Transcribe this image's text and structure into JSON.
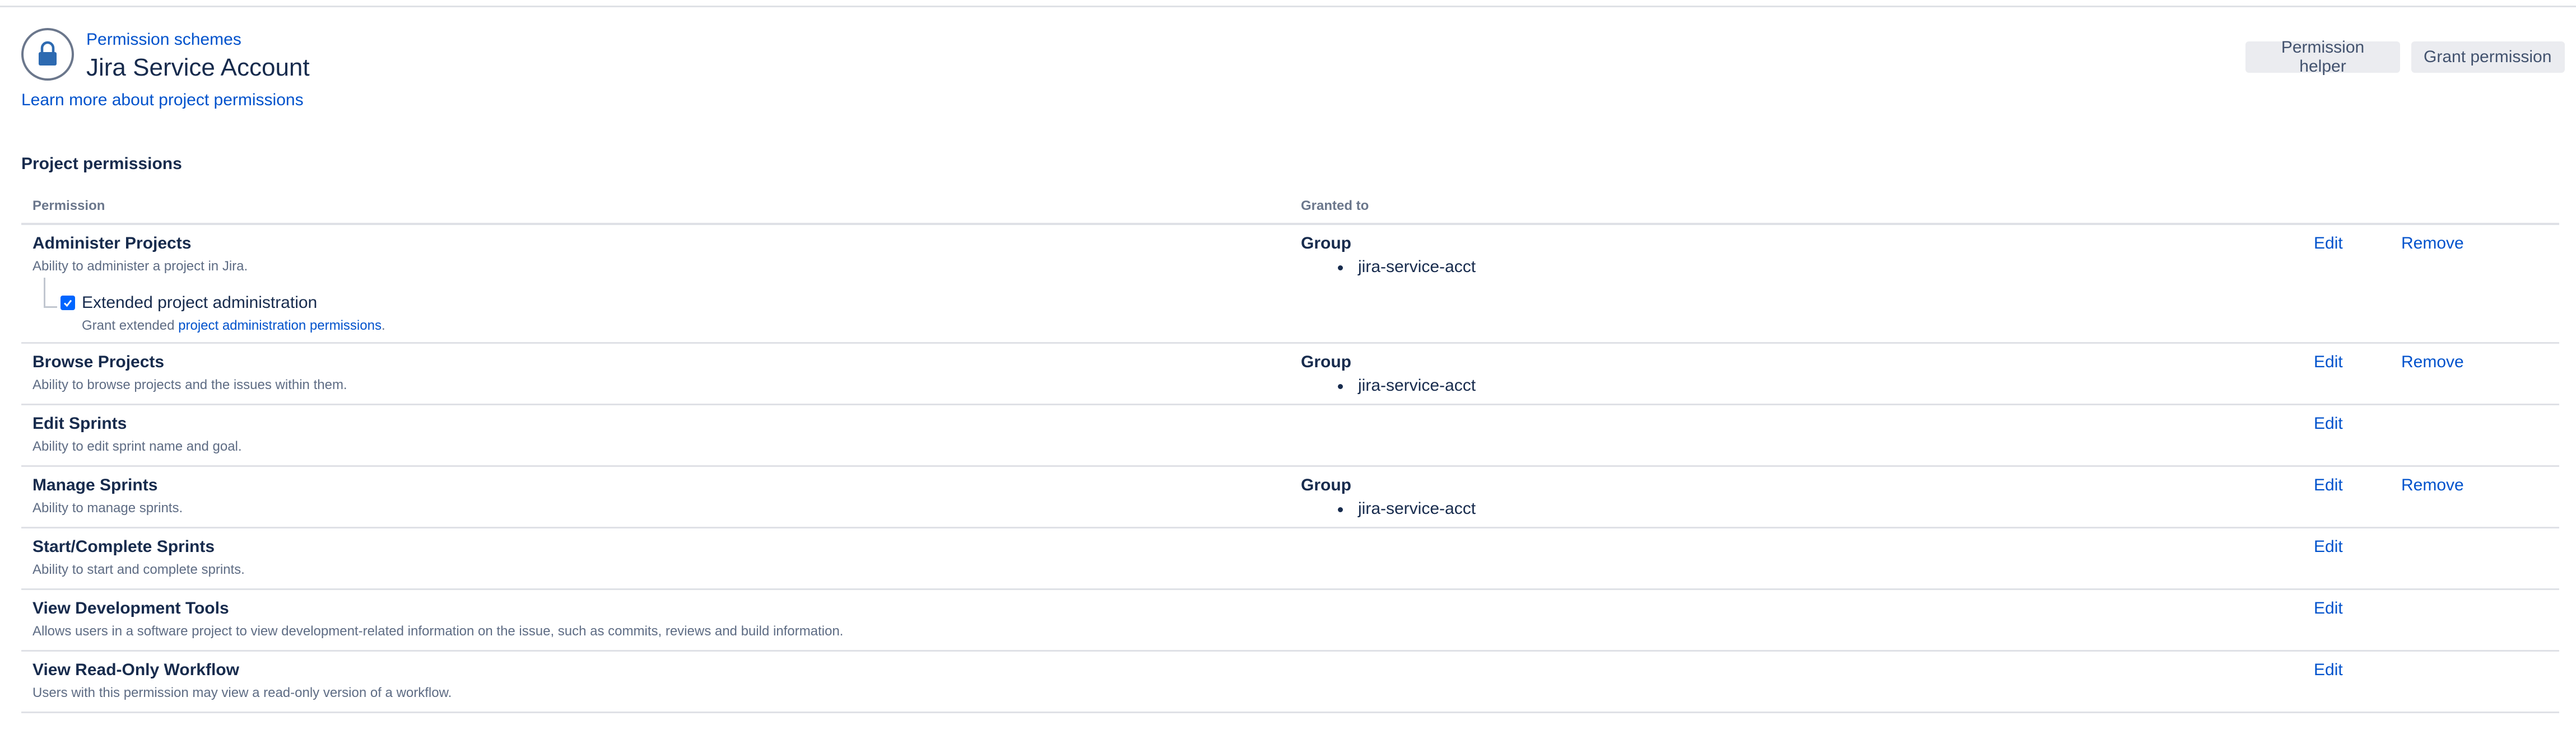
{
  "header": {
    "breadcrumb": "Permission schemes",
    "title": "Jira Service Account",
    "learn_more": "Learn more about project permissions",
    "permission_helper": "Permission helper",
    "grant_permission": "Grant permission",
    "icon": "lock-icon"
  },
  "section": {
    "title": "Project permissions"
  },
  "table": {
    "col_permission": "Permission",
    "col_granted": "Granted to",
    "edit_label": "Edit",
    "remove_label": "Remove",
    "group_label": "Group",
    "rows": [
      {
        "name": "Administer Projects",
        "description": "Ability to administer a project in Jira.",
        "group_member": "jira-service-acct",
        "extended": {
          "label": "Extended project administration",
          "checked": true,
          "hint_prefix": "Grant extended ",
          "hint_link": "project administration permissions",
          "hint_suffix": "."
        }
      },
      {
        "name": "Browse Projects",
        "description": "Ability to browse projects and the issues within them.",
        "group_member": "jira-service-acct"
      },
      {
        "name": "Edit Sprints",
        "description": "Ability to edit sprint name and goal."
      },
      {
        "name": "Manage Sprints",
        "description": "Ability to manage sprints.",
        "group_member": "jira-service-acct"
      },
      {
        "name": "Start/Complete Sprints",
        "description": "Ability to start and complete sprints."
      },
      {
        "name": "View Development Tools",
        "description": "Allows users in a software project to view development-related information on the issue, such as commits, reviews and build information."
      },
      {
        "name": "View Read-Only Workflow",
        "description": "Users with this permission may view a read-only version of a workflow."
      }
    ]
  },
  "colors": {
    "link": "#0052cc",
    "text": "#172b4d",
    "subtle": "#5e6c84",
    "button_bg": "#ebecf0",
    "checkbox": "#0065ff"
  }
}
